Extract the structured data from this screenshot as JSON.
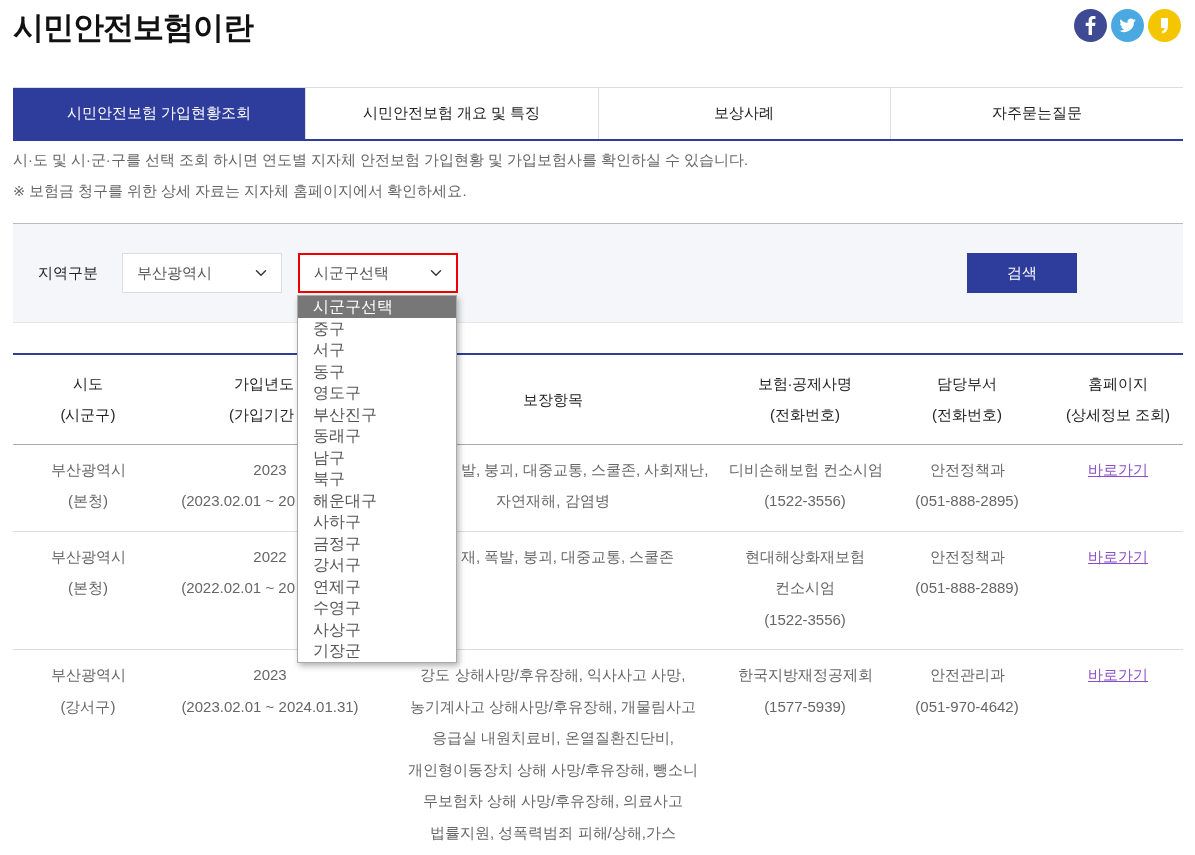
{
  "page_title": "시민안전보험이란",
  "tabs": [
    {
      "label": "시민안전보험 가입현황조회",
      "selected": true
    },
    {
      "label": "시민안전보험 개요 및 특징",
      "selected": false
    },
    {
      "label": "보상사례",
      "selected": false
    },
    {
      "label": "자주묻는질문",
      "selected": false
    }
  ],
  "notices": [
    "시·도 및 시·군·구를 선택 조회 하시면 연도별 지자체 안전보험 가입현황 및 가입보험사를 확인하실 수 있습니다.",
    "※ 보험금 청구를 위한 상세 자료는 지자체 홈페이지에서 확인하세요."
  ],
  "search": {
    "label": "지역구분",
    "region_value": "부산광역시",
    "district_value": "시군구선택",
    "district_focused": true,
    "button": "검색"
  },
  "district_options": [
    {
      "label": "시군구선택",
      "selected": true
    },
    {
      "label": "중구",
      "selected": false
    },
    {
      "label": "서구",
      "selected": false
    },
    {
      "label": "동구",
      "selected": false
    },
    {
      "label": "영도구",
      "selected": false
    },
    {
      "label": "부산진구",
      "selected": false
    },
    {
      "label": "동래구",
      "selected": false
    },
    {
      "label": "남구",
      "selected": false
    },
    {
      "label": "북구",
      "selected": false
    },
    {
      "label": "해운대구",
      "selected": false
    },
    {
      "label": "사하구",
      "selected": false
    },
    {
      "label": "금정구",
      "selected": false
    },
    {
      "label": "강서구",
      "selected": false
    },
    {
      "label": "연제구",
      "selected": false
    },
    {
      "label": "수영구",
      "selected": false
    },
    {
      "label": "사상구",
      "selected": false
    },
    {
      "label": "기장군",
      "selected": false
    }
  ],
  "table": {
    "columns": [
      {
        "lines": [
          "시도",
          "(시군구)"
        ]
      },
      {
        "lines": [
          {
            "text": "가입년도",
            "covered": true
          },
          {
            "text": "(가입기간",
            "covered": true
          }
        ]
      },
      {
        "lines": [
          {
            "text": "보장항목",
            "covered": false
          }
        ]
      },
      {
        "lines": [
          "보험·공제사명",
          "(전화번호)"
        ]
      },
      {
        "lines": [
          "담당부서",
          "(전화번호)"
        ]
      },
      {
        "lines": [
          "홈페이지",
          "(상세정보 조회)"
        ]
      }
    ],
    "rows": [
      {
        "cells": [
          {
            "lines": [
              "부산광역시",
              "(본청)"
            ]
          },
          {
            "lines": [
              {
                "text": "2023",
                "covered": false
              },
              {
                "text": "(2023.02.01 ~ 20",
                "covered": true
              }
            ]
          },
          {
            "lines": [
              {
                "text": "발, 붕괴, 대중교통, 스쿨존, 사회재난,",
                "covered": true
              },
              {
                "text": "자연재해, 감염병",
                "covered": false
              }
            ]
          },
          {
            "lines": [
              "디비손해보험 컨소시엄",
              "(1522-3556)"
            ]
          },
          {
            "lines": [
              "안전정책과",
              "(051-888-2895)"
            ]
          }
        ],
        "link": "바로가기",
        "visited": true
      },
      {
        "cells": [
          {
            "lines": [
              "부산광역시",
              "(본청)"
            ]
          },
          {
            "lines": [
              {
                "text": "2022",
                "covered": false
              },
              {
                "text": "(2022.02.01 ~ 20",
                "covered": true
              }
            ]
          },
          {
            "lines": [
              {
                "text": "재, 폭발, 붕괴, 대중교통, 스쿨존",
                "covered": true
              }
            ]
          },
          {
            "lines": [
              "현대해상화재보험",
              "컨소시엄",
              "(1522-3556)"
            ]
          },
          {
            "lines": [
              "안전정책과",
              "(051-888-2889)"
            ]
          }
        ],
        "link": "바로가기",
        "visited": true
      },
      {
        "cells": [
          {
            "lines": [
              "부산광역시",
              "(강서구)"
            ]
          },
          {
            "lines": [
              {
                "text": "2023",
                "covered": false
              },
              {
                "text": "(2023.02.01 ~ 2024.01.31)",
                "covered": false
              }
            ]
          },
          {
            "lines": [
              {
                "text": "강도 상해사망/후유장해, 익사사고 사망,",
                "covered": false
              },
              "농기계사고 상해사망/후유장해, 개물림사고",
              "응급실 내원치료비, 온열질환진단비,",
              "개인형이동장치 상해 사망/후유장해, 뺑소니",
              "무보험차 상해 사망/후유장해, 의료사고",
              "법률지원, 성폭력범죄 피해/상해,가스"
            ]
          },
          {
            "lines": [
              "한국지방재정공제회",
              "(1577-5939)"
            ]
          },
          {
            "lines": [
              "안전관리과",
              "(051-970-4642)"
            ]
          }
        ],
        "link": "바로가기",
        "visited": true
      }
    ]
  }
}
